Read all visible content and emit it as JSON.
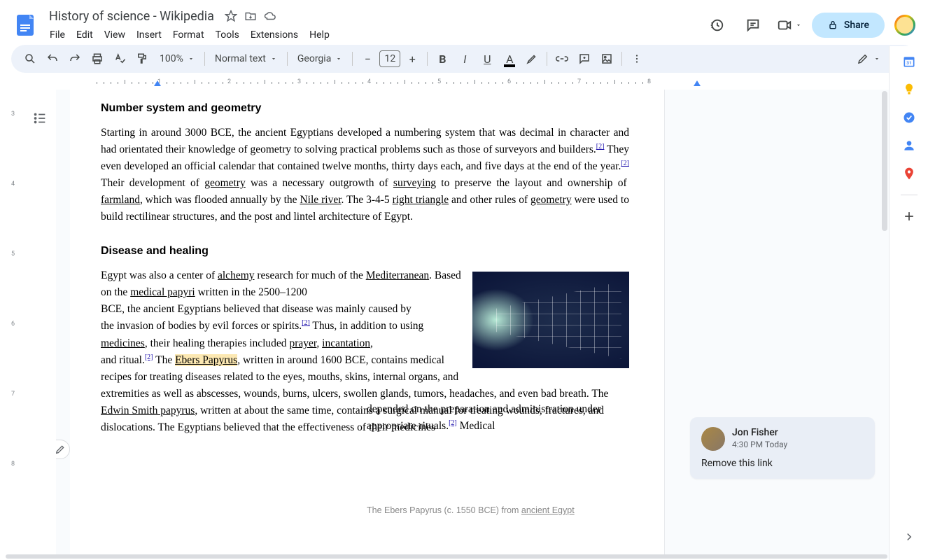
{
  "header": {
    "doc_title": "History of science - Wikipedia",
    "menus": [
      "File",
      "Edit",
      "View",
      "Insert",
      "Format",
      "Tools",
      "Extensions",
      "Help"
    ],
    "share_label": "Share"
  },
  "toolbar": {
    "zoom": "100%",
    "style": "Normal text",
    "font": "Georgia",
    "font_size": "12"
  },
  "ruler_h": [
    "1",
    "2",
    "3",
    "4",
    "5",
    "6",
    "7",
    "8"
  ],
  "ruler_v": [
    "3",
    "4",
    "5",
    "6",
    "7",
    "8"
  ],
  "document": {
    "section1_heading": "Number system and geometry",
    "section1_para": "Starting in around 3000 BCE, the ancient Egyptians developed a numbering system that was decimal in character and had orientated their knowledge of geometry to solving practical problems such as those of surveyors and builders.",
    "section1_ref1": "[2]",
    "section1_para2": " They even developed an official calendar that contained twelve months, thirty days each, and five days at the end of the year.",
    "section1_ref2": "[2]",
    "section1_para3a": " Their development of ",
    "link_geometry": "geometry",
    "section1_para3b": " was a necessary outgrowth of ",
    "link_surveying": "surveying",
    "section1_para3c": " to preserve the layout and ownership of ",
    "link_farmland": "farmland",
    "section1_para3d": ", which was flooded annually by the ",
    "link_nile": "Nile river",
    "section1_para3e": ". The 3-4-5 ",
    "link_right_triangle": "right triangle",
    "section1_para3f": " and other rules of ",
    "link_geometry2": "geometry",
    "section1_para3g": " were used to build rectilinear structures, and the post and lintel architecture of Egypt.",
    "section2_heading": "Disease and healing",
    "section2_p1a": "Egypt was also a center of ",
    "link_alchemy": "alchemy",
    "section2_p1b": " research for much of the ",
    "link_mediterranean": "Mediterranean",
    "section2_p1c": ". Based on the ",
    "link_medical_papyri": "medical papyri",
    "section2_p1d": " written in the 2500–1200",
    "section2_p2": "BCE, the ancient Egyptians believed that disease was mainly caused by",
    "section2_p3a": "the invasion of bodies by evil forces or spirits.",
    "section2_ref1": "[2]",
    "section2_p3b": " Thus, in addition to using ",
    "link_medicines": "medicines",
    "section2_p3c": ", their healing therapies included ",
    "link_prayer": "prayer",
    "section2_p3d": ", ",
    "link_incantation": "incantation",
    "section2_p3e": ",",
    "section2_p4a": "and ritual.",
    "section2_ref2": "[2]",
    "section2_p4b": " The ",
    "link_ebers": "Ebers Papyrus",
    "section2_p4c": ", written in around 1600 BCE, contains medical recipes for treating diseases related to the eyes, mouths, skins, internal organs, and extremities as well as abscesses, wounds, burns, ulcers, swollen glands, tumors, headaches, and even bad breath. The ",
    "link_edwin": "Edwin Smith papyrus",
    "section2_p4d": ", written at about the same time, contains a surgical manual for treating wounds, fractures, and dislocations. The Egyptians believed that the effectiveness of their medicines",
    "section2_p5a": "depended on the preparation and administration under appropriate rituals.",
    "section2_ref3": "[2]",
    "section2_p5b": " Medical",
    "caption_a": "The Ebers Papyrus (c. 1550 BCE) from ",
    "caption_link": "ancient Egypt"
  },
  "comment": {
    "author": "Jon Fisher",
    "time": "4:30 PM Today",
    "text": "Remove this link"
  }
}
